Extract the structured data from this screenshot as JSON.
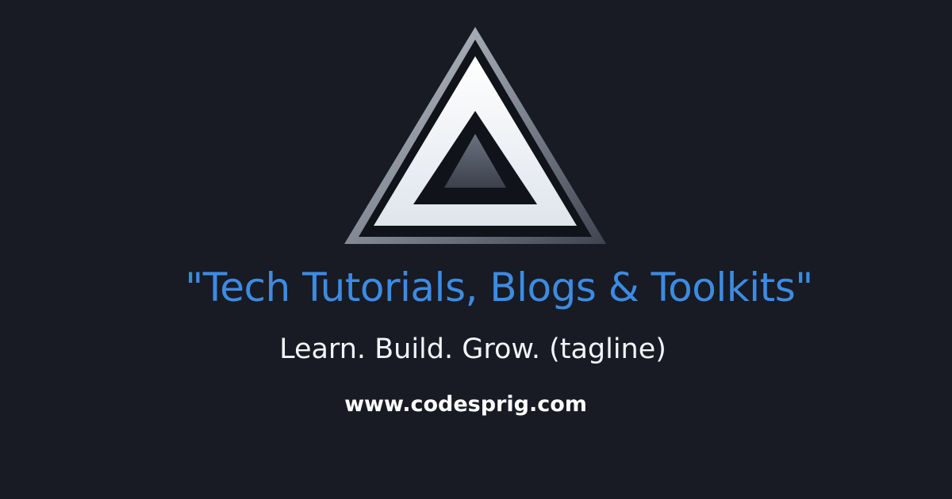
{
  "background": "#181b24",
  "logo": {
    "icon": "nested-triangle-logo-icon",
    "colors": {
      "outer": "#8a919c",
      "highlight": "#f4f7fb",
      "dark": "#11131a",
      "core": "#525866"
    }
  },
  "title": {
    "text": "\"Tech Tutorials, Blogs & Toolkits\"",
    "color": "#3d8be2"
  },
  "tagline": {
    "text": "Learn. Build. Grow. (tagline)",
    "color": "#f2f4f7"
  },
  "url": {
    "text": "www.codesprig.com",
    "color": "#ffffff"
  }
}
